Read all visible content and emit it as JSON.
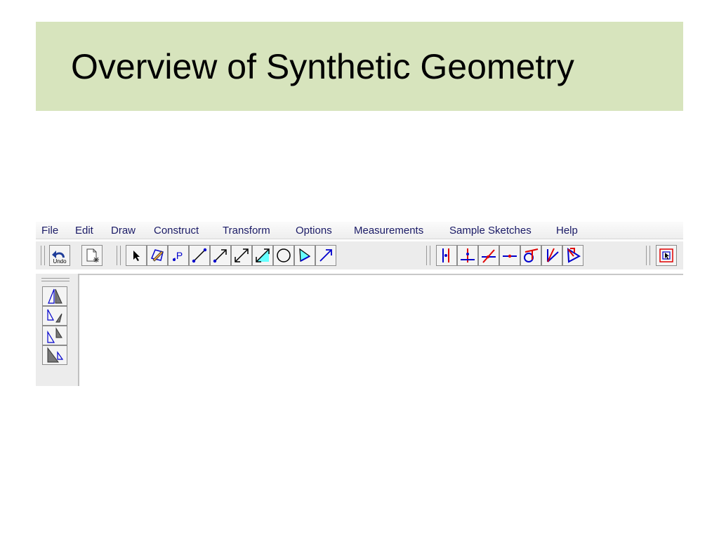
{
  "slide": {
    "title": "Overview of Synthetic Geometry"
  },
  "menu": [
    {
      "label": "File"
    },
    {
      "label": "Edit"
    },
    {
      "label": "Draw"
    },
    {
      "label": "Construct"
    },
    {
      "label": "Transform"
    },
    {
      "label": "Options"
    },
    {
      "label": "Measurements"
    },
    {
      "label": "Sample Sketches"
    },
    {
      "label": "Help"
    }
  ],
  "toolbar": {
    "undo_label": "Undo",
    "point_label": ".P"
  },
  "colors": {
    "title_bg": "#d7e4bd",
    "accent_blue": "#0000cc",
    "accent_red": "#e00000",
    "fill_cyan": "#66ffff"
  },
  "tools": [
    {
      "icon": "undo-icon"
    },
    {
      "icon": "new-sketch-icon"
    },
    {
      "icon": "select-arrow-icon"
    },
    {
      "icon": "polygon-pencil-icon"
    },
    {
      "icon": "point-icon"
    },
    {
      "icon": "segment-icon"
    },
    {
      "icon": "ray-icon"
    },
    {
      "icon": "line-icon"
    },
    {
      "icon": "vector-icon"
    },
    {
      "icon": "circle-icon"
    },
    {
      "icon": "filled-polygon-icon"
    },
    {
      "icon": "arrow-icon"
    },
    {
      "icon": "perpendicular-icon"
    },
    {
      "icon": "perpendicular-bisector-icon"
    },
    {
      "icon": "intersection-icon"
    },
    {
      "icon": "midpoint-icon"
    },
    {
      "icon": "tangent-icon"
    },
    {
      "icon": "angle-bisector-icon"
    },
    {
      "icon": "triangle-angle-icon"
    },
    {
      "icon": "selection-rectangle-icon"
    }
  ],
  "side_tools": [
    {
      "icon": "reflect-icon"
    },
    {
      "icon": "rotate-icon"
    },
    {
      "icon": "translate-icon"
    },
    {
      "icon": "dilate-icon"
    }
  ]
}
